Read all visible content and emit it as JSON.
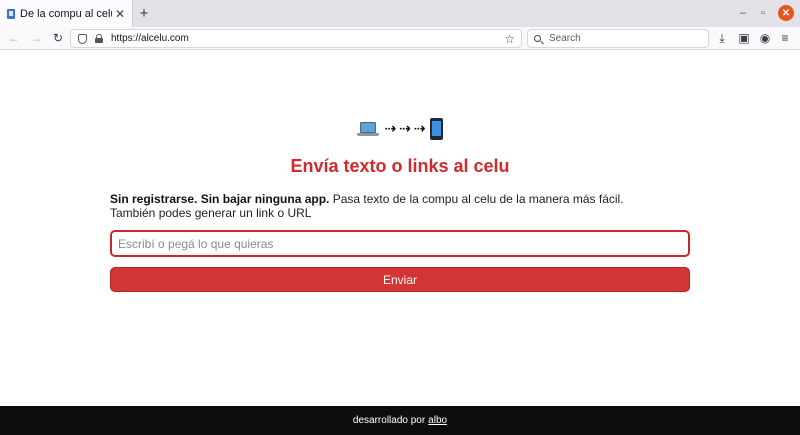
{
  "browser": {
    "tab": {
      "title": "De la compu al celu",
      "close_glyph": "✕"
    },
    "new_tab_glyph": "+",
    "window_controls": {
      "minimize": "–",
      "restore": "▫",
      "close": "✕"
    },
    "nav": {
      "back": "←",
      "forward": "→",
      "reload": "↻"
    },
    "url": "https://alcelu.com",
    "bookmark_star": "☆",
    "search_placeholder": "Search",
    "toolbar_icons": [
      "download-icon",
      "screenshot-icon",
      "extension-icon",
      "menu-icon"
    ],
    "toolbar_glyphs": {
      "download": "⤓",
      "screenshot": "▣",
      "extension": "◉",
      "menu": "≡"
    }
  },
  "page": {
    "hero_arrows": "⇢ ⇢ ⇢",
    "title": "Envía texto o links al celu",
    "desc_bold": "Sin registrarse. Sin bajar ninguna app.",
    "desc_rest": " Pasa texto de la compu al celu de la manera más fácil. También podes generar un link o URL",
    "input_placeholder": "Escribí o pegá lo que quieras",
    "send_label": "Enviar"
  },
  "footer": {
    "text": "desarrollado por",
    "link": "albo"
  },
  "colors": {
    "accent": "#d12a2a",
    "button": "#d33434",
    "footer_bg": "#0d0d0d"
  }
}
